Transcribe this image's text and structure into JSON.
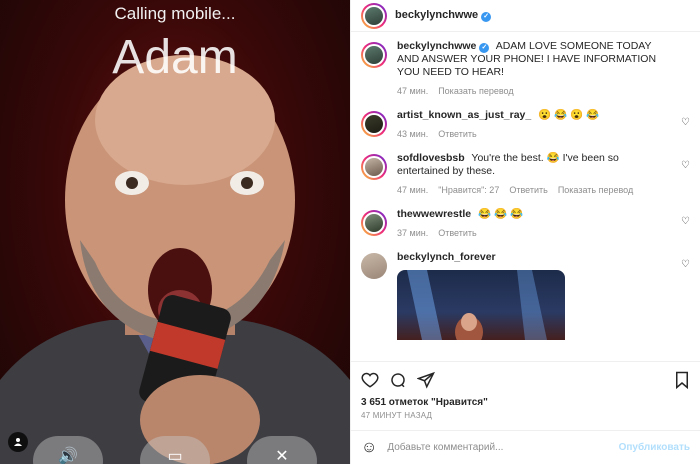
{
  "call": {
    "status": "Calling mobile...",
    "name": "Adam",
    "buttons": [
      "speaker-icon",
      "video-icon",
      "mute-icon"
    ]
  },
  "post": {
    "author": "beckylynchwwe",
    "caption_user": "beckylynchwwe",
    "caption": "ADAM LOVE SOMEONE TODAY AND ANSWER YOUR PHONE! I HAVE INFORMATION YOU NEED TO HEAR!",
    "caption_time": "47 мин.",
    "caption_translate": "Показать перевод",
    "likes": "3 651 отметок \"Нравится\"",
    "posted_ago": "47 МИНУТ НАЗАД",
    "comment_placeholder": "Добавьте комментарий...",
    "publish_label": "Опубликовать"
  },
  "comments": [
    {
      "user": "artist_known_as_just_ray_",
      "text": "😮 😂 😮 😂",
      "time": "43 мин.",
      "reply": "Ответить"
    },
    {
      "user": "sofdlovesbsb",
      "text": "You're the best. 😂 I've been so entertained by these.",
      "time": "47 мин.",
      "likes": "\"Нравится\": 27",
      "reply": "Ответить",
      "translate": "Показать перевод"
    },
    {
      "user": "thewwewrestle",
      "text": "😂 😂 😂",
      "time": "37 мин.",
      "reply": "Ответить"
    },
    {
      "user": "beckylynch_forever",
      "text": ""
    }
  ]
}
